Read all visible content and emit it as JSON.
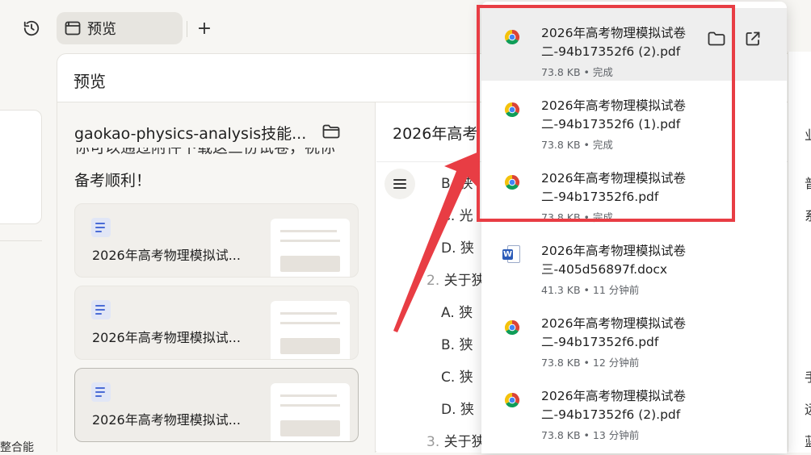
{
  "topbar": {
    "tab_label": "预览",
    "add_tab": "+"
  },
  "left": {
    "partial_text": "整合能"
  },
  "preview": {
    "title": "预览",
    "files": {
      "title": "gaokao-physics-analysis技能...",
      "partial_line": "你可以通过附件下载这三份试卷，祝你",
      "sub_line": "备考顺利！",
      "cards": [
        {
          "name": "2026年高考物理模拟试..."
        },
        {
          "name": "2026年高考物理模拟试..."
        },
        {
          "name": "2026年高考物理模拟试..."
        }
      ]
    },
    "doc": {
      "title": "2026年高考",
      "outline": [
        {
          "num": "",
          "text": "B. 狭"
        },
        {
          "num": "",
          "text": "C. 光"
        },
        {
          "num": "",
          "text": "D. 狭"
        },
        {
          "num": "2.",
          "text": "关于狭"
        },
        {
          "num": "",
          "text": "A. 狭"
        },
        {
          "num": "",
          "text": "B. 狭"
        },
        {
          "num": "",
          "text": "C. 狭"
        },
        {
          "num": "",
          "text": "D. 狭"
        },
        {
          "num": "3.",
          "text": "关于狭"
        }
      ]
    },
    "right_edge_chars": [
      "业",
      "普",
      "系",
      "手",
      "远",
      "蓝"
    ]
  },
  "downloads": {
    "items": [
      {
        "name_line1": "2026年高考物理模拟试卷",
        "name_line2": "二-94b17352f6 (2).pdf",
        "meta": "73.8 KB • 完成",
        "type": "pdf"
      },
      {
        "name_line1": "2026年高考物理模拟试卷",
        "name_line2": "二-94b17352f6 (1).pdf",
        "meta": "73.8 KB • 完成",
        "type": "pdf"
      },
      {
        "name_line1": "2026年高考物理模拟试卷",
        "name_line2": "二-94b17352f6.pdf",
        "meta": "73.8 KB • 完成",
        "type": "pdf"
      },
      {
        "name_line1": "2026年高考物理模拟试卷",
        "name_line2": "三-405d56897f.docx",
        "meta": "41.3 KB • 11 分钟前",
        "type": "docx"
      },
      {
        "name_line1": "2026年高考物理模拟试卷",
        "name_line2": "二-94b17352f6.pdf",
        "meta": "73.8 KB • 12 分钟前",
        "type": "pdf"
      },
      {
        "name_line1": "2026年高考物理模拟试卷",
        "name_line2": "二-94b17352f6 (2).pdf",
        "meta": "73.8 KB • 13 分钟前",
        "type": "pdf"
      }
    ],
    "word_icon_letter": "W"
  },
  "colors": {
    "annotation_red": "#e83d44",
    "chrome_red": "#db4437",
    "chrome_yellow": "#f4c20d",
    "chrome_green": "#0f9d58",
    "chrome_blue": "#4285f4",
    "word_blue": "#2b5bb8"
  },
  "icons": {
    "history": "history-icon",
    "tab": "browser-tab-icon",
    "folder": "folder-icon",
    "open_external": "open-external-icon",
    "menu": "menu-icon",
    "doc": "document-icon",
    "chrome": "chrome-icon",
    "word": "word-file-icon"
  }
}
